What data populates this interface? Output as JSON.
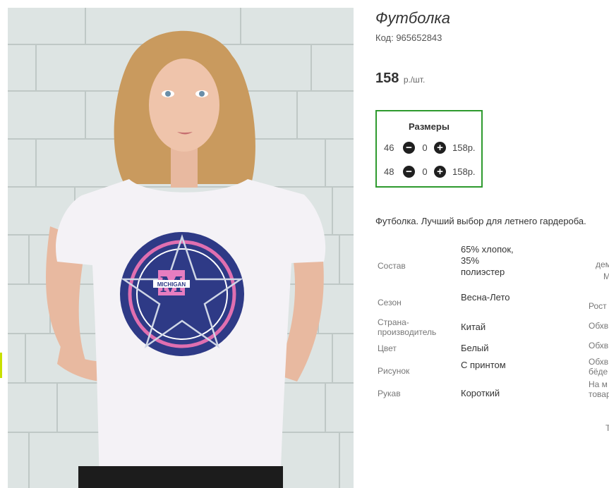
{
  "product": {
    "title": "Футболка",
    "code": "Код: 965652843",
    "price": "158",
    "price_unit": "р./шт.",
    "description": "Футболка. Лучший выбор для летнего гардероба."
  },
  "sizes": {
    "title": "Размеры",
    "rows": [
      {
        "size": "46",
        "minus": "−",
        "qty": "0",
        "plus": "+",
        "price": "158р."
      },
      {
        "size": "48",
        "minus": "−",
        "qty": "0",
        "plus": "+",
        "price": "158р."
      }
    ]
  },
  "properties": [
    {
      "key": "Состав",
      "value": "65% хлопок, 35% полиэстер"
    },
    {
      "key": "Сезон",
      "value": "Весна-Лето"
    },
    {
      "key": "Страна-производитель",
      "value": "Китай"
    },
    {
      "key": "Цвет",
      "value": "Белый"
    },
    {
      "key": "Рисунок",
      "value": "С принтом"
    },
    {
      "key": "Рукав",
      "value": "Короткий"
    }
  ],
  "right_column": [
    "дем",
    "М",
    "Рост",
    "Обхв",
    "Обхв",
    "Обхв",
    "бёде",
    "На м",
    "товар",
    "Т"
  ],
  "print": {
    "text": "MICHIGAN",
    "letter": "M"
  },
  "colors": {
    "accent_border": "#2e9a2e",
    "print_navy": "#2e3a86",
    "print_pink": "#e06fb0"
  }
}
